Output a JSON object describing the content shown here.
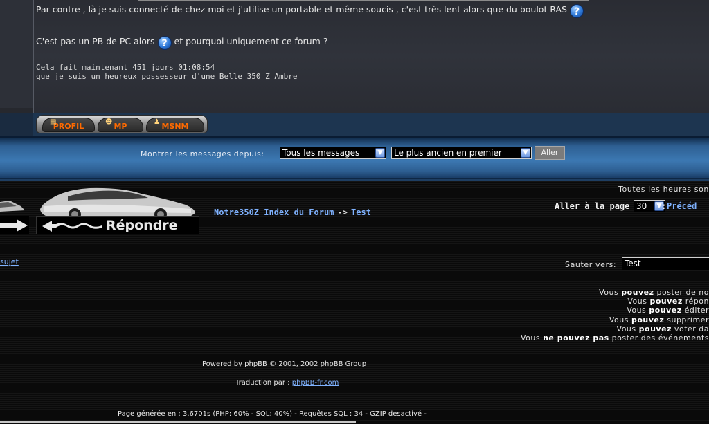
{
  "post": {
    "line1": "Par contre , là je suis connecté de chez moi et j'utilise un portable et même soucis , c'est très lent alors que du boulot RAS",
    "line2_before": "C'est pas un PB de PC alors",
    "line2_after": "et pourquoi uniquement ce forum ?",
    "help_icon_glyph": "?",
    "signature_line1": "Cela fait maintenant 451 jours 01:08:54",
    "signature_line2": "que je suis un heureux possesseur d'une Belle 350 Z Ambre"
  },
  "profile_buttons": [
    {
      "label": "PROFIL",
      "icon": "profile-card-icon"
    },
    {
      "label": "MP",
      "icon": "users-message-icon"
    },
    {
      "label": "MSNM",
      "icon": "msn-icon"
    }
  ],
  "display_options": {
    "label": "Montrer les messages depuis:",
    "since_selected": "Tous les messages",
    "order_selected": "Le plus ancien en premier",
    "go_label": "Aller"
  },
  "navigation": {
    "breadcrumb_forum": "Notre350Z Index du Forum",
    "breadcrumb_sep": "->",
    "breadcrumb_topic": "Test",
    "reply_label": "Répondre",
    "timezone_text": "Toutes les heures son",
    "goto_label": "Aller à la page",
    "page_selected": "30",
    "goto_sep": ":",
    "prev_link": "Précéd",
    "subject_link": "sujet",
    "jump_label": "Sauter vers:",
    "jump_selected": "Test"
  },
  "permissions": [
    {
      "pre": "Vous ",
      "bold": "pouvez",
      "post": " poster de no"
    },
    {
      "pre": "Vous ",
      "bold": "pouvez",
      "post": " répon"
    },
    {
      "pre": "Vous ",
      "bold": "pouvez",
      "post": " éditer"
    },
    {
      "pre": "Vous ",
      "bold": "pouvez",
      "post": " supprimer"
    },
    {
      "pre": "Vous ",
      "bold": "pouvez",
      "post": " voter da"
    },
    {
      "pre": "Vous ",
      "bold": "ne pouvez pas",
      "post": " poster des événements"
    }
  ],
  "footer": {
    "powered_by": "Powered by phpBB © 2001, 2002 phpBB Group",
    "translation_label": "Traduction par :",
    "translation_link": "phpBB-fr.com",
    "generated": "Page générée en : 3.6701s (PHP: 60% - SQL: 40%) - Requêtes SQL : 34 - GZIP desactivé -"
  },
  "colors": {
    "link": "#7fb2ff",
    "accent_orange": "#ff6a00",
    "band_blue": "#3c78b2"
  }
}
